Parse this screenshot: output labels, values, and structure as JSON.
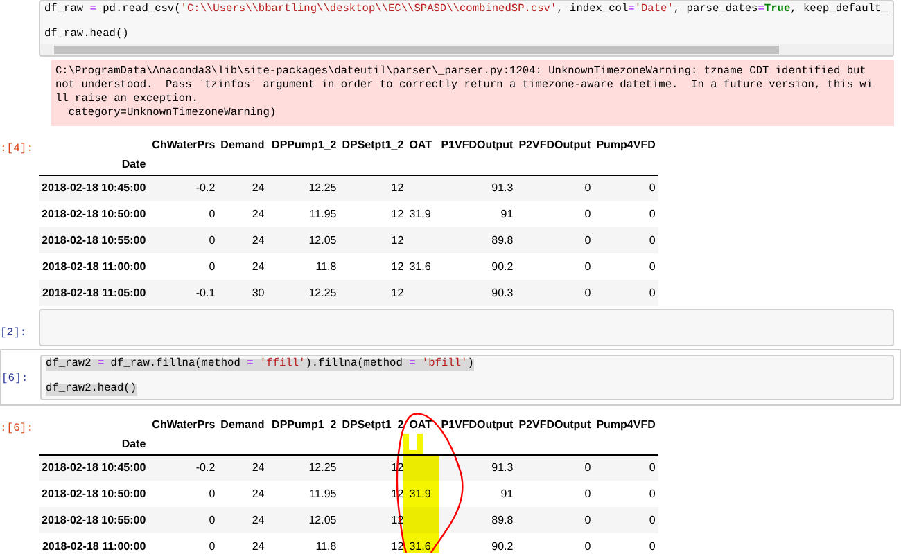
{
  "cells": [
    {
      "kind": "code",
      "selected": false,
      "scrollbar": true,
      "lines": [
        [
          {
            "kind": "plain",
            "s": "df_raw "
          },
          {
            "kind": "op",
            "s": "="
          },
          {
            "kind": "plain",
            "s": " pd.read_csv("
          },
          {
            "kind": "str",
            "s": "'C:\\\\Users\\\\bbartling\\\\desktop\\\\EC\\\\SPASD\\\\combinedSP.csv'"
          },
          {
            "kind": "plain",
            "s": ", index_col"
          },
          {
            "kind": "op",
            "s": "="
          },
          {
            "kind": "str",
            "s": "'Date'"
          },
          {
            "kind": "plain",
            "s": ", parse_dates"
          },
          {
            "kind": "op",
            "s": "="
          },
          {
            "kind": "kw",
            "s": "True"
          },
          {
            "kind": "plain",
            "s": ", keep_default_"
          }
        ],
        [
          {
            "kind": "plain",
            "s": "df_raw.head()"
          }
        ]
      ]
    },
    {
      "kind": "warning",
      "lines": [
        "C:\\ProgramData\\Anaconda3\\lib\\site-packages\\dateutil\\parser\\_parser.py:1204: UnknownTimezoneWarning: tzname CDT identified but",
        "not understood.  Pass `tzinfos` argument in order to correctly return a timezone-aware datetime.  In a future version, this wi",
        "ll raise an exception.",
        "  category=UnknownTimezoneWarning)"
      ]
    },
    {
      "kind": "table",
      "prompt": ":[4]:",
      "columns": [
        null,
        "ChWaterPrs",
        "Demand",
        "DPPump1_2",
        "DPSetpt1_2",
        "OAT",
        "P1VFDOutput",
        "P2VFDOutput",
        "Pump4VFD"
      ],
      "index_name": "Date",
      "rows": [
        [
          "2018-02-18 10:45:00",
          "-0.2",
          "24",
          "12.25",
          "12",
          null,
          "91.3",
          "0",
          "0"
        ],
        [
          "2018-02-18 10:50:00",
          "0",
          "24",
          "11.95",
          "12",
          "31.9",
          "91",
          "0",
          "0"
        ],
        [
          "2018-02-18 10:55:00",
          "0",
          "24",
          "12.05",
          "12",
          null,
          "89.8",
          "0",
          "0"
        ],
        [
          "2018-02-18 11:00:00",
          "0",
          "24",
          "11.8",
          "12",
          "31.6",
          "90.2",
          "0",
          "0"
        ],
        [
          "2018-02-18 11:05:00",
          "-0.1",
          "30",
          "12.25",
          "12",
          null,
          "90.3",
          "0",
          "0"
        ]
      ]
    },
    {
      "kind": "code",
      "prompt": "[2]:",
      "selected": false
    },
    {
      "kind": "code",
      "prompt": "[6]:",
      "selected": true,
      "lines": [
        [
          {
            "kind": "plain",
            "s": "df_raw2 "
          },
          {
            "kind": "op",
            "s": "="
          },
          {
            "kind": "plain",
            "s": " df_raw.fillna(method "
          },
          {
            "kind": "op",
            "s": "="
          },
          {
            "kind": "str",
            "s": " 'ffill'"
          },
          {
            "kind": "plain",
            "s": ").fillna(method "
          },
          {
            "kind": "op",
            "s": "="
          },
          {
            "kind": "str",
            "s": " 'bfill'"
          },
          {
            "kind": "plain",
            "s": ")"
          }
        ],
        [
          {
            "kind": "plain",
            "s": "df_raw2.head()"
          }
        ]
      ]
    },
    {
      "kind": "table",
      "prompt": ":[6]:",
      "annotated": true,
      "columns": [
        null,
        "ChWaterPrs",
        "Demand",
        "DPPump1_2",
        "DPSetpt1_2",
        "OAT",
        "P1VFDOutput",
        "P2VFDOutput",
        "Pump4VFD"
      ],
      "index_name": "Date",
      "rows": [
        [
          "2018-02-18 10:45:00",
          "-0.2",
          "24",
          "12.25",
          "12",
          null,
          "91.3",
          "0",
          "0"
        ],
        [
          "2018-02-18 10:50:00",
          "0",
          "24",
          "11.95",
          "12",
          "31.9",
          "91",
          "0",
          "0"
        ],
        [
          "2018-02-18 10:55:00",
          "0",
          "24",
          "12.05",
          "12",
          null,
          "89.8",
          "0",
          "0"
        ],
        [
          "2018-02-18 11:00:00",
          "0",
          "24",
          "11.8",
          "12",
          "31.6",
          "90.2",
          "0",
          "0"
        ]
      ]
    }
  ]
}
